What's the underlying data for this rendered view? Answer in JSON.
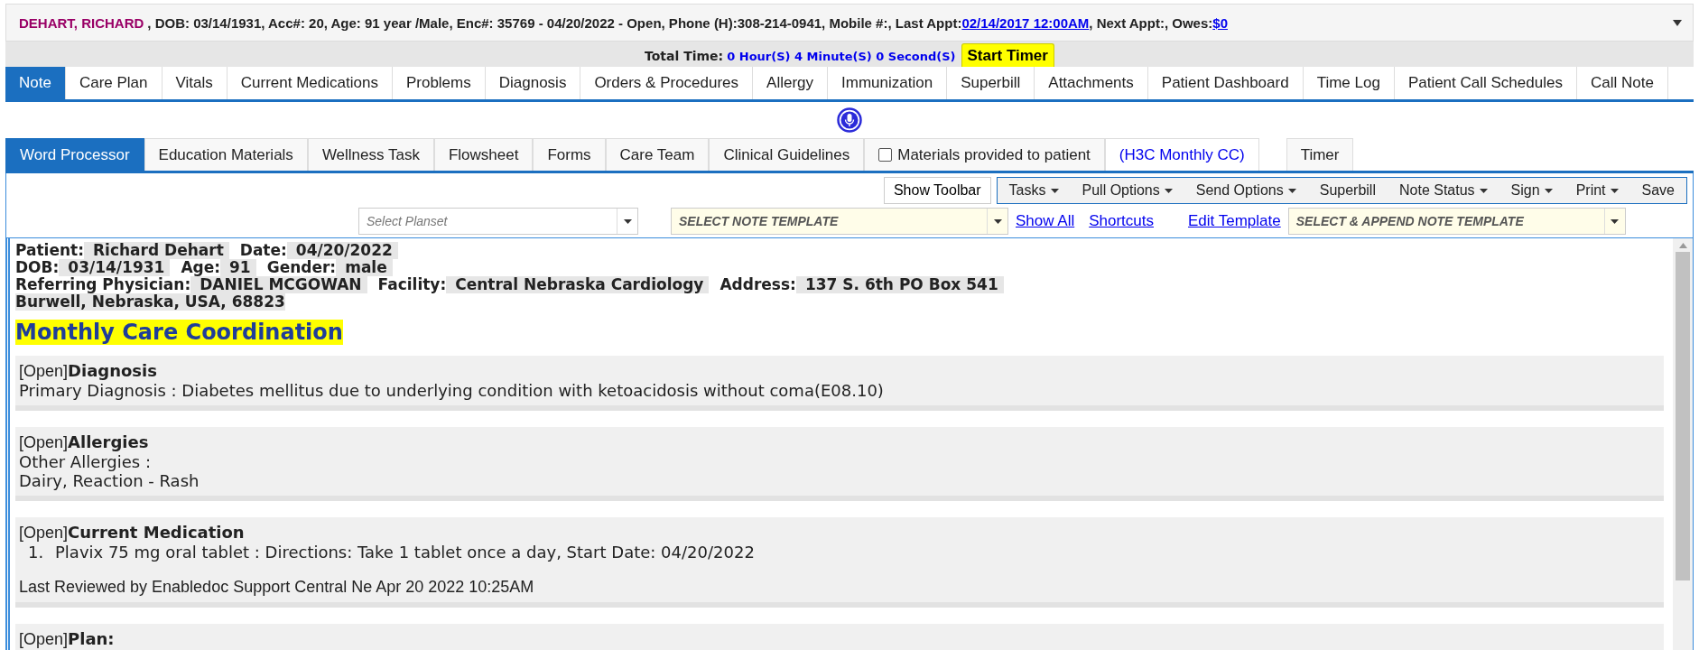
{
  "patient_banner": {
    "name": "DEHART, RICHARD",
    "details": ", DOB: 03/14/1931, Acc#: 20, Age: 91 year /Male, Enc#: 35769 - 04/20/2022 - Open, Phone (H):308-214-0941, Mobile #:, Last Appt:",
    "last_appt": "02/14/2017 12:00AM",
    "next_appt": ", Next Appt:, Owes:",
    "owes": "$0"
  },
  "timer": {
    "label": "Total Time:",
    "value": "0 Hour(S) 4 Minute(S) 0 Second(S)",
    "button": "Start Timer"
  },
  "main_tabs": [
    {
      "label": "Note",
      "selected": true
    },
    {
      "label": "Care Plan",
      "selected": false
    },
    {
      "label": "Vitals",
      "selected": false
    },
    {
      "label": "Current Medications",
      "selected": false
    },
    {
      "label": "Problems",
      "selected": false
    },
    {
      "label": "Diagnosis",
      "selected": false
    },
    {
      "label": "Orders & Procedures",
      "selected": false
    },
    {
      "label": "Allergy",
      "selected": false
    },
    {
      "label": "Immunization",
      "selected": false
    },
    {
      "label": "Superbill",
      "selected": false
    },
    {
      "label": "Attachments",
      "selected": false
    },
    {
      "label": "Patient Dashboard",
      "selected": false
    },
    {
      "label": "Time Log",
      "selected": false
    },
    {
      "label": "Patient Call Schedules",
      "selected": false
    },
    {
      "label": "Call Note",
      "selected": false
    }
  ],
  "sub_tabs": [
    {
      "kind": "tab",
      "label": "Word Processor",
      "selected": true
    },
    {
      "kind": "tab",
      "label": "Education Materials",
      "selected": false
    },
    {
      "kind": "tab",
      "label": "Wellness Task",
      "selected": false
    },
    {
      "kind": "tab",
      "label": "Flowsheet",
      "selected": false
    },
    {
      "kind": "tab",
      "label": "Forms",
      "selected": false
    },
    {
      "kind": "tab",
      "label": "Care Team",
      "selected": false
    },
    {
      "kind": "tab",
      "label": "Clinical Guidelines",
      "selected": false
    },
    {
      "kind": "checkbox",
      "label": "Materials provided to patient",
      "checked": false
    },
    {
      "kind": "link",
      "label": "(H3C Monthly CC)"
    },
    {
      "kind": "tab",
      "label": "Timer",
      "selected": false
    }
  ],
  "toolbar": {
    "show_toolbar": "Show Toolbar",
    "actions": [
      {
        "label": "Tasks",
        "dropdown": true
      },
      {
        "label": "Pull Options",
        "dropdown": true
      },
      {
        "label": "Send Options",
        "dropdown": true
      },
      {
        "label": "Superbill",
        "dropdown": false
      },
      {
        "label": "Note Status",
        "dropdown": true
      },
      {
        "label": "Sign",
        "dropdown": true
      },
      {
        "label": "Print",
        "dropdown": true
      },
      {
        "label": "Save",
        "dropdown": false
      }
    ]
  },
  "template_bar": {
    "planset": {
      "placeholder": "Select Planset"
    },
    "note_template": {
      "placeholder": "SELECT NOTE TEMPLATE"
    },
    "links": [
      "Show All",
      "Shortcuts",
      "Edit Template"
    ],
    "append_template": {
      "placeholder": "SELECT & APPEND NOTE TEMPLATE"
    }
  },
  "note": {
    "header_lines": [
      [
        {
          "label": "Patient:",
          "value": "Richard Dehart"
        },
        {
          "label": "Date:",
          "value": "04/20/2022"
        }
      ],
      [
        {
          "label": "DOB:",
          "value": "03/14/1931"
        },
        {
          "label": "Age:",
          "value": "91"
        },
        {
          "label": "Gender:",
          "value": "male"
        }
      ],
      [
        {
          "label": "Referring Physician:",
          "value": "DANIEL MCGOWAN"
        },
        {
          "label": "Facility:",
          "value": "Central Nebraska Cardiology"
        },
        {
          "label": "Address:",
          "value": "137 S. 6th PO Box 541"
        }
      ],
      [
        {
          "value": "Burwell, Nebraska, USA, 68823"
        }
      ]
    ],
    "title": "Monthly Care Coordination",
    "sections": [
      {
        "status": "[Open]",
        "title": "Diagnosis",
        "lines": [
          {
            "kind": "text",
            "text": "Primary Diagnosis : Diabetes mellitus due to underlying condition with ketoacidosis without coma(E08.10)"
          }
        ]
      },
      {
        "status": "[Open]",
        "title": "Allergies",
        "lines": [
          {
            "kind": "text",
            "text": "Other Allergies :"
          },
          {
            "kind": "text",
            "text": "Dairy, Reaction - Rash"
          }
        ]
      },
      {
        "status": "[Open]",
        "title": "Current Medication",
        "lines": [
          {
            "kind": "list_item",
            "number": "1.",
            "text": "Plavix 75 mg oral tablet : Directions: Take 1 tablet once a day, Start Date: 04/20/2022"
          },
          {
            "kind": "note",
            "text": "Last Reviewed by Enabledoc Support Central Ne Apr 20 2022 10:25AM"
          }
        ]
      },
      {
        "status": "[Open]",
        "title": "Plan:"
      }
    ]
  }
}
